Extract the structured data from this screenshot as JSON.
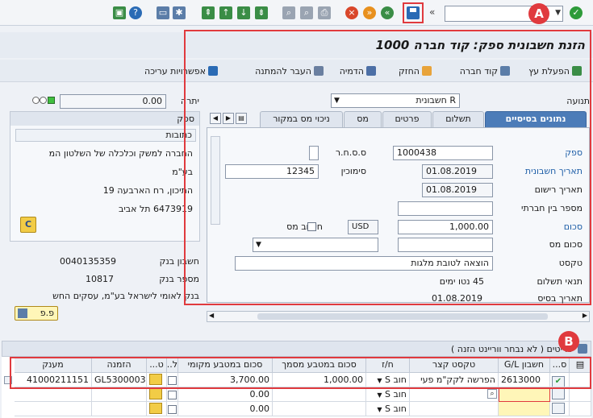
{
  "toolbar": {
    "command_value": "",
    "chevron": "«",
    "marker_a": "A",
    "marker_b": "B"
  },
  "header": {
    "title": "הזנת חשבונית ספק: קוד חברה 1000",
    "actions": [
      {
        "label": "הפעלת עץ",
        "icon": "tree-icon"
      },
      {
        "label": "קוד חברה",
        "icon": "company-code-icon"
      },
      {
        "label": "החזק",
        "icon": "hold-icon"
      },
      {
        "label": "הדמיה",
        "icon": "simulate-icon"
      },
      {
        "label": "העבר להמתנה",
        "icon": "park-icon"
      },
      {
        "label": "אפשרויות עריכה",
        "icon": "pencil-icon"
      }
    ]
  },
  "left": {
    "balance_label": "יתרה",
    "balance_value": "0.00",
    "vendor_panel_title": "ספק",
    "address_title": "כתובות",
    "address_lines": [
      "החברה למשק וכלכלה של השלטון המ",
      "בע\"מ",
      "התיכון, רח הארבעה 19",
      "6473919 תל אביב"
    ],
    "bank_account_label": "חשבון בנק",
    "bank_account_value": "0040135359",
    "bank_number_label": "מספר בנק",
    "bank_number_value": "10817",
    "bank_name": "בנק לאומי לישראל בע\"מ,  עסקים החש",
    "open_items_label": "פ.פ"
  },
  "form": {
    "transaction_label": "תנועה",
    "transaction_value": "R חשבונית",
    "tabs": [
      "נתונים בסיסיים",
      "תשלום",
      "פרטים",
      "מס",
      "ניכוי מס במקור"
    ],
    "vendor_label": "ספק",
    "vendor_value": "1000438",
    "sshr_label": "ס.ס.ח.ר",
    "invoice_date_label": "תאריך חשבונית",
    "invoice_date_value": "01.08.2019",
    "reference_label": "סימוכין",
    "reference_value": "12345",
    "posting_date_label": "תאריך רישום",
    "posting_date_value": "01.08.2019",
    "intercompany_label": "מספר בין חברתי",
    "amount_label": "סכום",
    "amount_value": "1,000.00",
    "currency_value": "USD",
    "calc_tax_label": "חישוב מס",
    "tax_amount_label": "סכום מס",
    "text_label": "טקסט",
    "text_value": "הוצאה לטובת מלגות",
    "payment_terms_label": "תנאי תשלום",
    "payment_terms_value": "45 נטו ימים",
    "baseline_date_label": "תאריך בסיס",
    "baseline_date_value": "01.08.2019"
  },
  "items": {
    "title": "פריטים ( לא נבחר ווריינט הזנה )",
    "columns": [
      "ס...",
      "חשבון G/L",
      "טקסט קצר",
      "ח/ז",
      "סכום במטבע מסמך",
      "סכום במטבע מקומי",
      "ל...",
      "ט...",
      "הזמנה",
      "מענק"
    ],
    "rows": [
      {
        "gl": "2613000",
        "text": "הפרשה לקק\"מ פעי",
        "dc": "חוב S",
        "doc_amt": "1,000.00",
        "loc_amt": "3,700.00",
        "order": "GL5300003",
        "grant": "41000211151"
      },
      {
        "gl": "",
        "text": "",
        "dc": "חוב S",
        "doc_amt": "",
        "loc_amt": "0.00",
        "order": "",
        "grant": ""
      },
      {
        "gl": "",
        "text": "",
        "dc": "חוב S",
        "doc_amt": "",
        "loc_amt": "0.00",
        "order": "",
        "grant": ""
      }
    ]
  }
}
